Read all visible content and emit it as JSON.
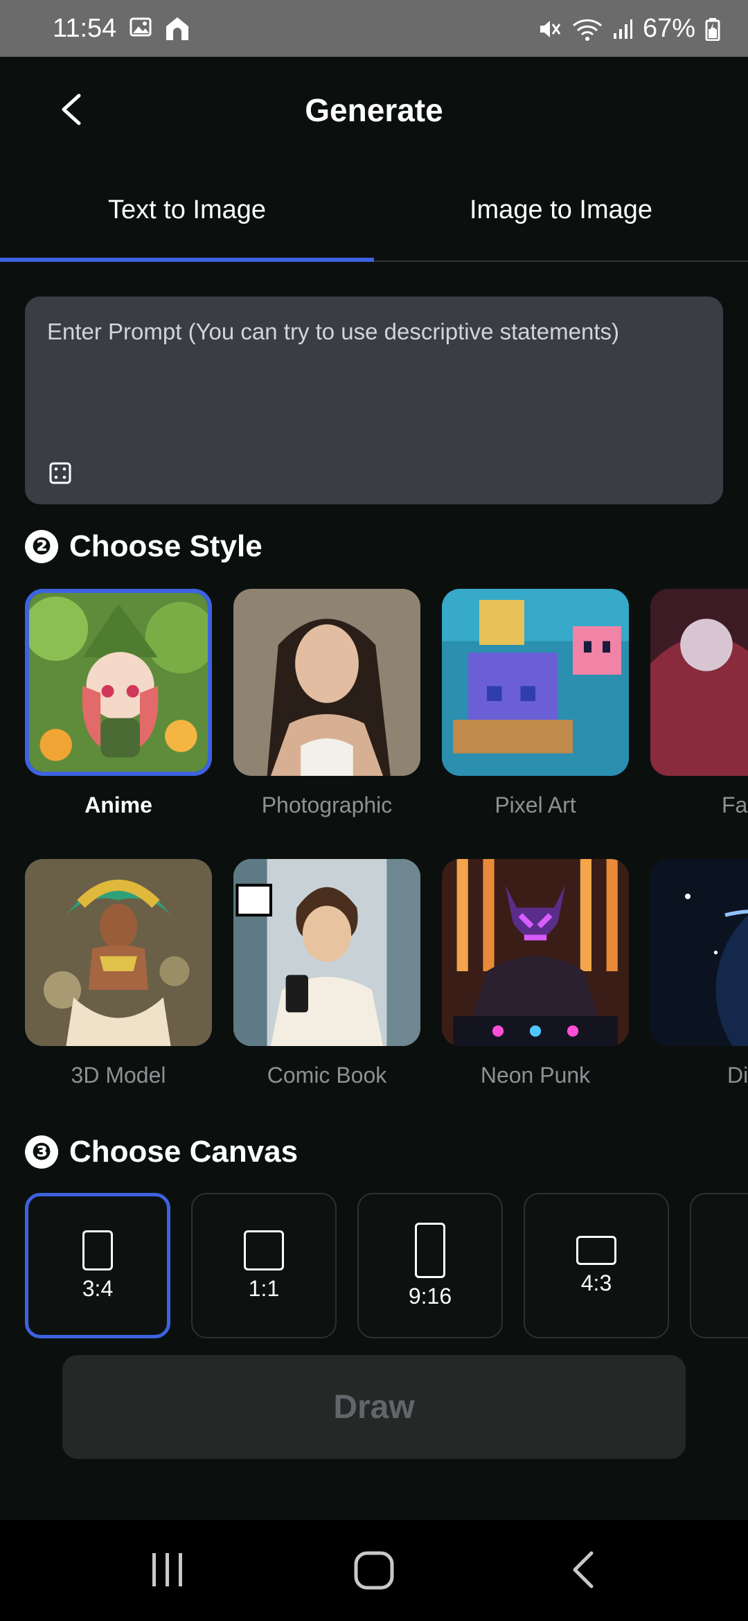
{
  "status_bar": {
    "time": "11:54",
    "battery": "67%"
  },
  "header": {
    "title": "Generate"
  },
  "tabs": [
    {
      "label": "Text to Image",
      "active": true
    },
    {
      "label": "Image to Image",
      "active": false
    }
  ],
  "prompt": {
    "placeholder": "Enter Prompt (You can try to use descriptive statements)",
    "value": ""
  },
  "style_section": {
    "number": "❷",
    "title": "Choose Style",
    "items": [
      {
        "label": "Anime",
        "selected": true
      },
      {
        "label": "Photographic",
        "selected": false
      },
      {
        "label": "Pixel Art",
        "selected": false
      },
      {
        "label": "Fant",
        "selected": false
      },
      {
        "label": "3D Model",
        "selected": false
      },
      {
        "label": "Comic Book",
        "selected": false
      },
      {
        "label": "Neon Punk",
        "selected": false
      },
      {
        "label": "Dig",
        "selected": false
      }
    ]
  },
  "canvas_section": {
    "number": "❸",
    "title": "Choose Canvas",
    "items": [
      {
        "label": "3:4",
        "selected": true
      },
      {
        "label": "1:1",
        "selected": false
      },
      {
        "label": "9:16",
        "selected": false
      },
      {
        "label": "4:3",
        "selected": false
      }
    ]
  },
  "draw_button": {
    "label": "Draw"
  },
  "colors": {
    "accent": "#3d63e0",
    "background": "#0b100e",
    "prompt_bg": "#3a3d44"
  }
}
